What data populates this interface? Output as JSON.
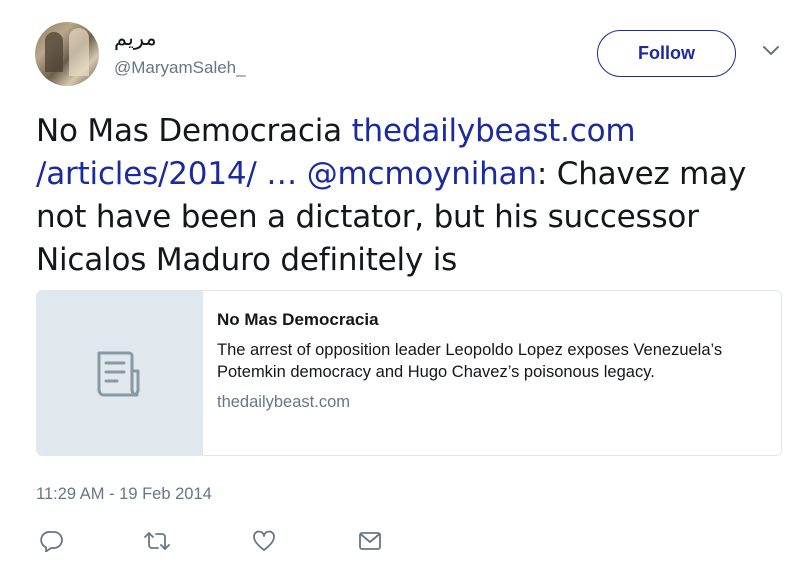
{
  "user": {
    "display_name": "مريم",
    "handle": "@MaryamSaleh_",
    "avatar": "profile-photo"
  },
  "follow_button": {
    "label": "Follow"
  },
  "tweet": {
    "text_prefix": "No Mas Democracia ",
    "link_1": "thedailybeast.com /articles/2014/ …",
    "mention": "@mcmoynihan",
    "text_suffix": ": Chavez may not have been a dictator, but his successor Nicalos Maduro definitely is"
  },
  "card": {
    "thumbnail_icon": "document-icon",
    "title": "No Mas Democracia",
    "description": "The arrest of opposition leader Leopoldo Lopez exposes Venezuela’s Potemkin democracy and Hugo Chavez’s poisonous legacy.",
    "domain": "thedailybeast.com"
  },
  "timestamp": "11:29 AM - 19 Feb 2014",
  "actions": [
    "reply-icon",
    "retweet-icon",
    "like-icon",
    "direct-message-icon"
  ],
  "colors": {
    "link": "#1b2a9e",
    "secondary": "#657786",
    "border": "#e1e8ed"
  }
}
